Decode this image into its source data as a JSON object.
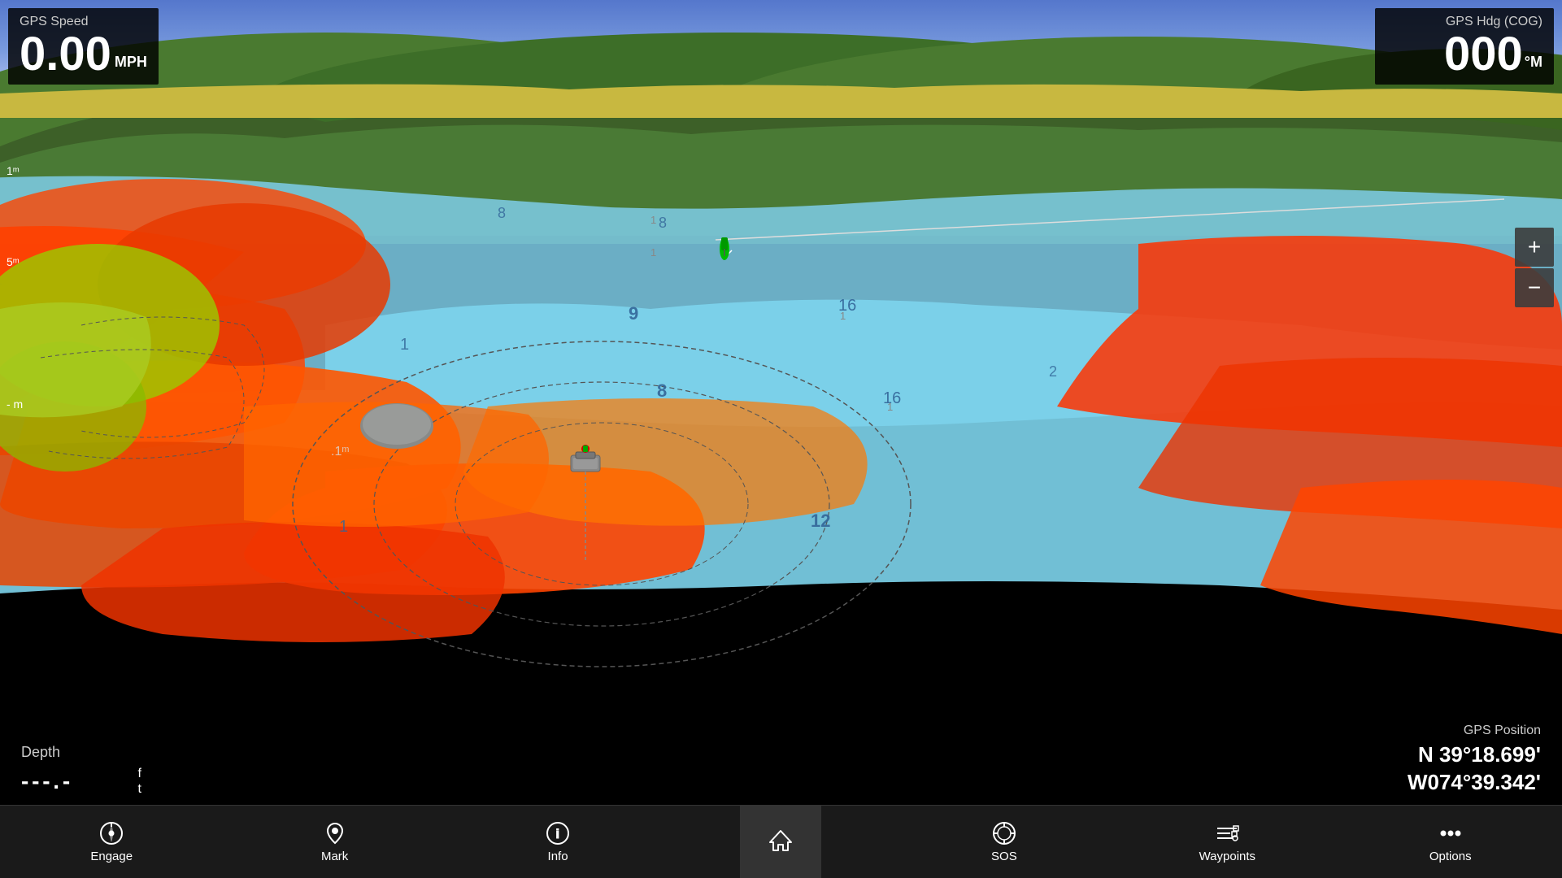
{
  "gps_speed": {
    "label": "GPS Speed",
    "value": "0.00",
    "unit_line1": "MPH",
    "unit_line2": ""
  },
  "gps_hdg": {
    "label": "GPS Hdg (COG)",
    "value": "000",
    "unit": "°M"
  },
  "depth": {
    "label": "Depth",
    "dash": "- - - . -",
    "unit_top": "f",
    "unit_bottom": "t"
  },
  "gps_position": {
    "label": "GPS Position",
    "lat": "N  39°18.699'",
    "lon": "W074°39.342'"
  },
  "scale_markers": [
    {
      "value": "1 m"
    },
    {
      "value": "5 m"
    },
    {
      "value": "- m"
    }
  ],
  "zoom": {
    "plus_label": "+",
    "minus_label": "−"
  },
  "nav_bar": {
    "items": [
      {
        "id": "engage",
        "label": "Engage",
        "icon": "compass"
      },
      {
        "id": "mark",
        "label": "Mark",
        "icon": "pin"
      },
      {
        "id": "info",
        "label": "Info",
        "icon": "info"
      },
      {
        "id": "home",
        "label": "",
        "icon": "home",
        "active": true
      },
      {
        "id": "sos",
        "label": "SOS",
        "icon": "sos"
      },
      {
        "id": "waypoints",
        "label": "Waypoints",
        "icon": "waypoints"
      },
      {
        "id": "options",
        "label": "Options",
        "icon": "options"
      }
    ]
  }
}
